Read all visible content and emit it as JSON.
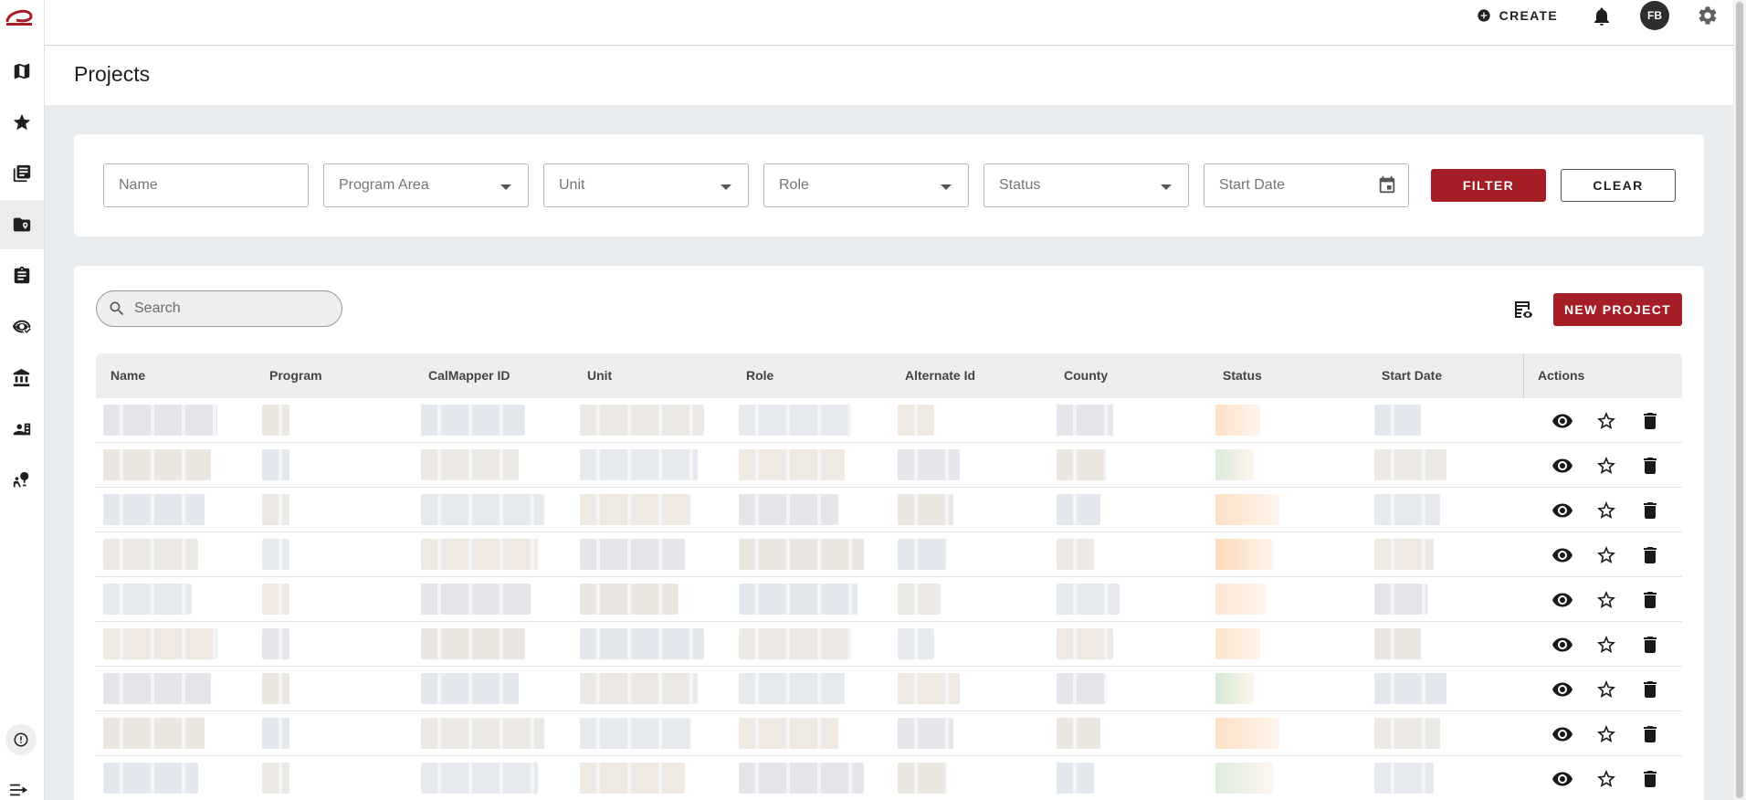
{
  "topbar": {
    "create_label": "CREATE",
    "avatar_initials": "FB"
  },
  "page": {
    "title": "Projects"
  },
  "filters": {
    "name_placeholder": "Name",
    "program_area_placeholder": "Program Area",
    "unit_placeholder": "Unit",
    "role_placeholder": "Role",
    "status_placeholder": "Status",
    "start_date_placeholder": "Start Date",
    "filter_label": "FILTER",
    "clear_label": "CLEAR"
  },
  "table": {
    "search_placeholder": "Search",
    "new_project_label": "NEW PROJECT",
    "columns": [
      "Name",
      "Program",
      "CalMapper ID",
      "Unit",
      "Role",
      "Alternate Id",
      "County",
      "Status",
      "Start Date",
      "Actions"
    ]
  },
  "colors": {
    "accent": "#a51d25",
    "header_bg": "#eceef0",
    "page_bg": "#e9ecef"
  },
  "icons": {
    "sidebar": [
      "map-icon",
      "star-icon",
      "stacked-files-icon",
      "folder-location-icon",
      "clipboard-icon",
      "eye-check-icon",
      "bank-icon",
      "contact-card-icon",
      "tree-person-icon",
      "info-icon",
      "expand-arrow-icon"
    ],
    "row_actions": [
      "view-icon",
      "favorite-icon",
      "delete-icon"
    ]
  }
}
